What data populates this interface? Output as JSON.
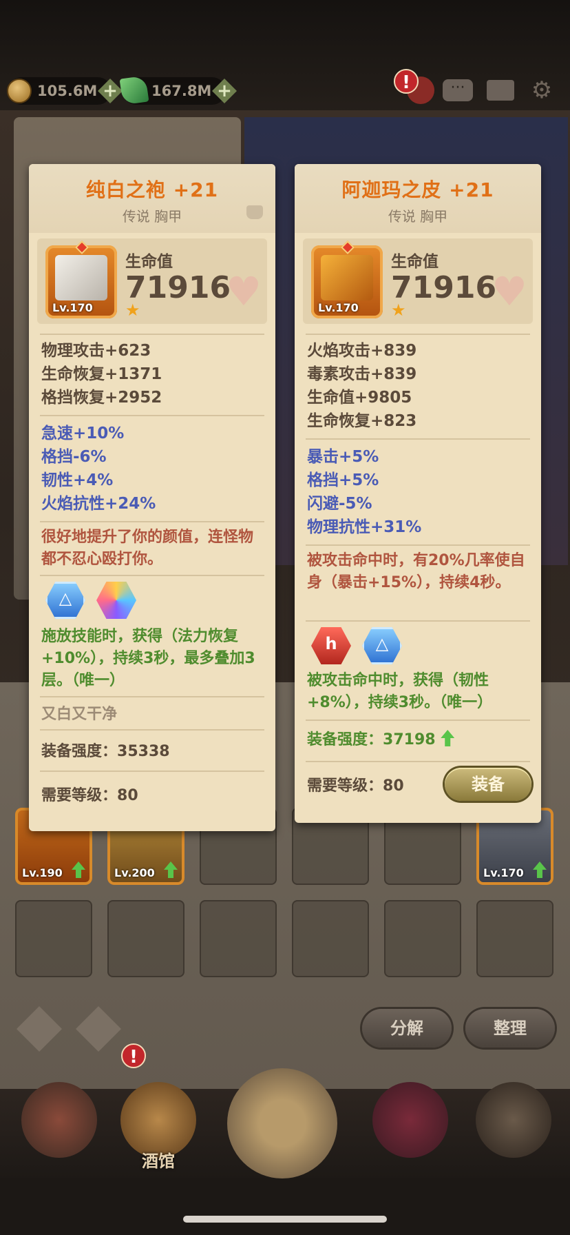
{
  "resources": {
    "gold": "105.6M",
    "gems": "167.8M"
  },
  "top_icons": [
    "hero-icon",
    "chat-icon",
    "mail-icon",
    "settings-icon"
  ],
  "badges": {
    "alert": "!"
  },
  "cards": [
    {
      "title": "纯白之袍 +21",
      "subtitle": "传说 胸甲",
      "level": "Lv.170",
      "main_stat_label": "生命值",
      "main_stat_value": "71916",
      "base_stats": [
        "物理攻击+623",
        "生命恢复+1371",
        "格挡恢复+2952"
      ],
      "bonus_stats": [
        "急速+10%",
        "格挡-6%",
        "韧性+4%",
        "火焰抗性+24%"
      ],
      "effect_text": "很好地提升了你的颜值，连怪物都不忍心殴打你。",
      "gem_effect": "施放技能时，获得（法力恢复+10%），持续3秒，最多叠加3层。（唯一）",
      "flavor": "又白又干净",
      "power_label": "装备强度：",
      "power_value": "35338",
      "req_label": "需要等级：",
      "req_value": "80"
    },
    {
      "title": "阿迦玛之皮 +21",
      "subtitle": "传说 胸甲",
      "level": "Lv.170",
      "main_stat_label": "生命值",
      "main_stat_value": "71916",
      "base_stats": [
        "火焰攻击+839",
        "毒素攻击+839",
        "生命值+9805",
        "生命恢复+823"
      ],
      "bonus_stats": [
        "暴击+5%",
        "格挡+5%",
        "闪避-5%",
        "物理抗性+31%"
      ],
      "effect_text": "被攻击命中时，有20%几率使自身（暴击+15%），持续4秒。",
      "gem_effect": "被攻击命中时，获得（韧性+8%），持续3秒。（唯一）",
      "power_label": "装备强度：",
      "power_value": "37198",
      "req_label": "需要等级：",
      "req_value": "80",
      "equip_label": "装备"
    }
  ],
  "inventory": {
    "slots": [
      {
        "level": "Lv.190"
      },
      {
        "level": "Lv.200"
      },
      {
        "level": "Lv.170"
      }
    ],
    "decompose_label": "分解",
    "sort_label": "整理"
  },
  "nav": {
    "tavern_label": "酒馆"
  }
}
